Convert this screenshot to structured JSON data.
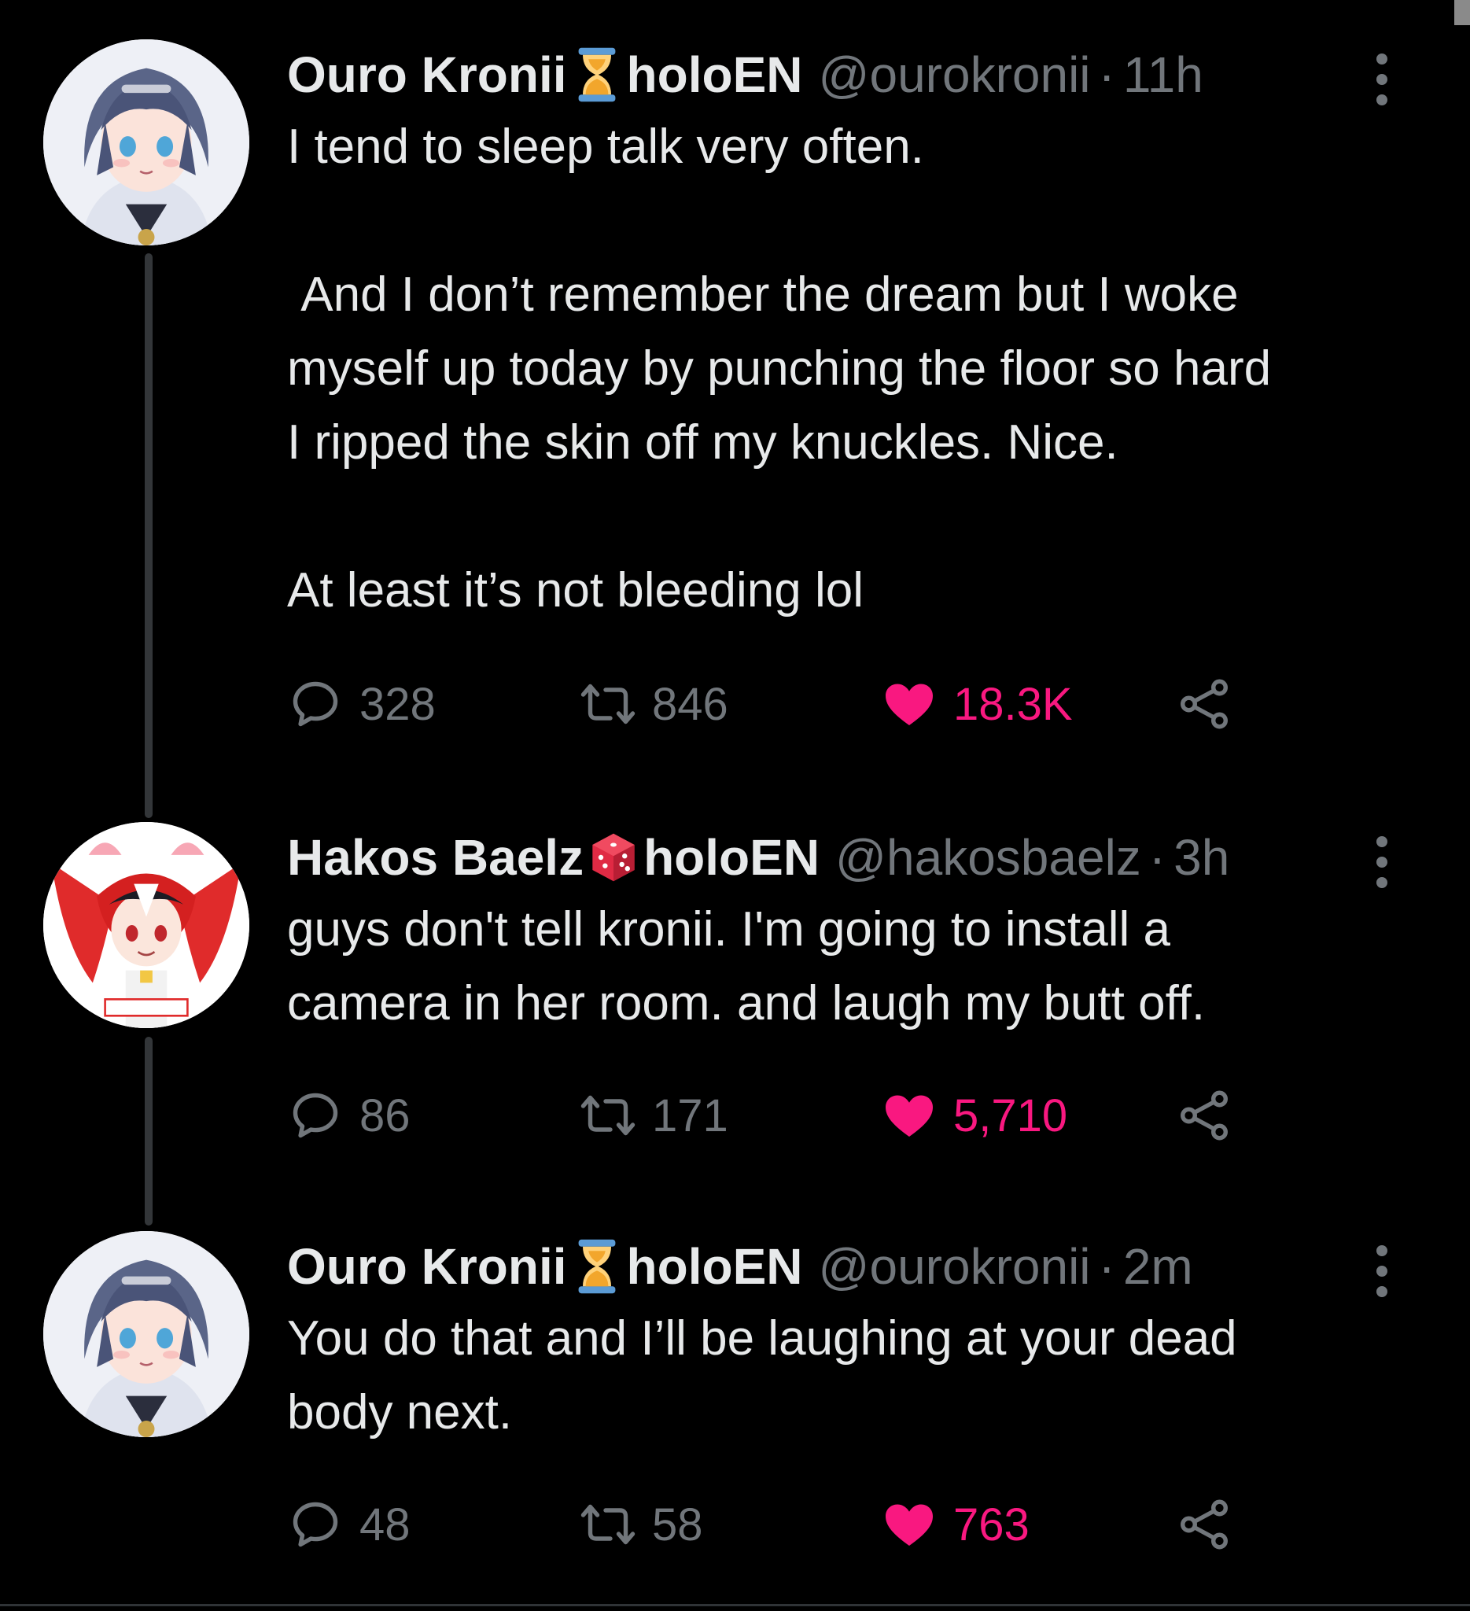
{
  "colors": {
    "background": "#000000",
    "text": "#e7e9ea",
    "muted": "#71767b",
    "like": "#f91880",
    "thread_line": "#333639"
  },
  "tweets": [
    {
      "display_name": "Ouro Kronii",
      "badge_icon": "hourglass-emoji",
      "org": "holoEN",
      "handle": "@ourokronii",
      "dot": "·",
      "time": "11h",
      "text": "I tend to sleep talk very often.\n\n And I don’t remember the dream but I woke\nmyself up today by punching the floor so hard\nI ripped the skin off my knuckles. Nice.\n\nAt least it’s not bleeding lol",
      "replies": "328",
      "retweets": "846",
      "likes": "18.3K",
      "liked": true
    },
    {
      "display_name": "Hakos Baelz",
      "badge_icon": "dice-emoji",
      "org": "holoEN",
      "handle": "@hakosbaelz",
      "dot": "·",
      "time": "3h",
      "text": "guys don't tell kronii. I'm going to install a\ncamera in her room. and laugh my butt off.",
      "replies": "86",
      "retweets": "171",
      "likes": "5,710",
      "liked": true
    },
    {
      "display_name": "Ouro Kronii",
      "badge_icon": "hourglass-emoji",
      "org": "holoEN",
      "handle": "@ourokronii",
      "dot": "·",
      "time": "2m",
      "text": "You do that and I’ll be laughing at your dead\nbody next.",
      "replies": "48",
      "retweets": "58",
      "likes": "763",
      "liked": true
    }
  ]
}
